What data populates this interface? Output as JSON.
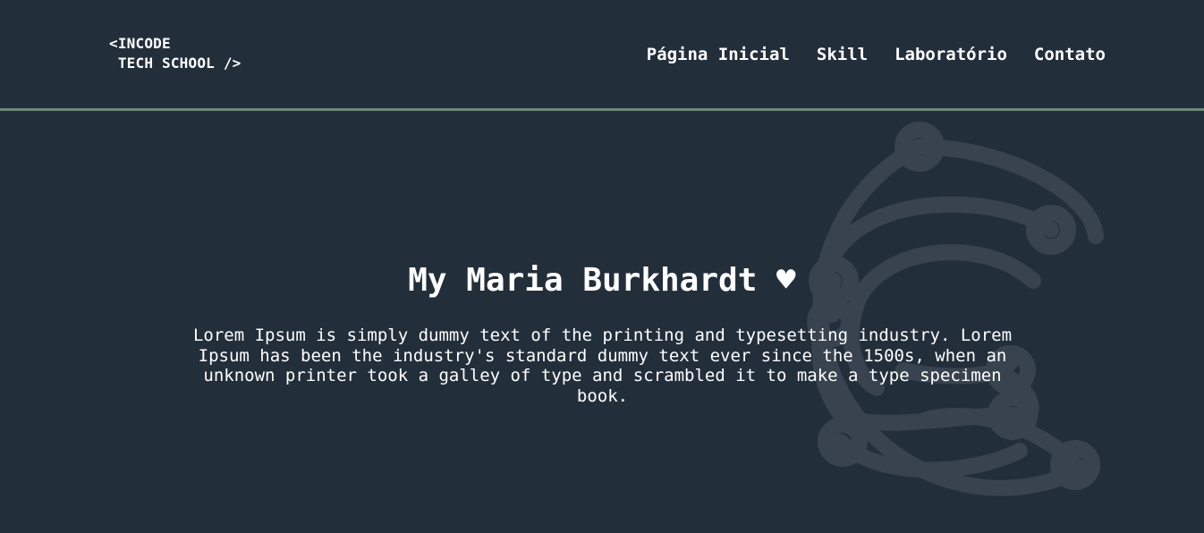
{
  "header": {
    "logo_line1": "<INCODE",
    "logo_line2": " TECH SCHOOL />",
    "nav": [
      {
        "label": "Página Inicial"
      },
      {
        "label": "Skill"
      },
      {
        "label": "Laboratório"
      },
      {
        "label": "Contato"
      }
    ]
  },
  "hero": {
    "title": "My Maria Burkhardt ♥",
    "text": "Lorem Ipsum is simply dummy text of the printing and typesetting industry. Lorem Ipsum has been the industry's standard dummy text ever since the 1500s, when an unknown printer took a galley of type and scrambled it to make a type specimen book."
  },
  "colors": {
    "background": "#232e3b",
    "divider": "#6e8878",
    "graphic": "#39434f",
    "text": "#ffffff"
  }
}
